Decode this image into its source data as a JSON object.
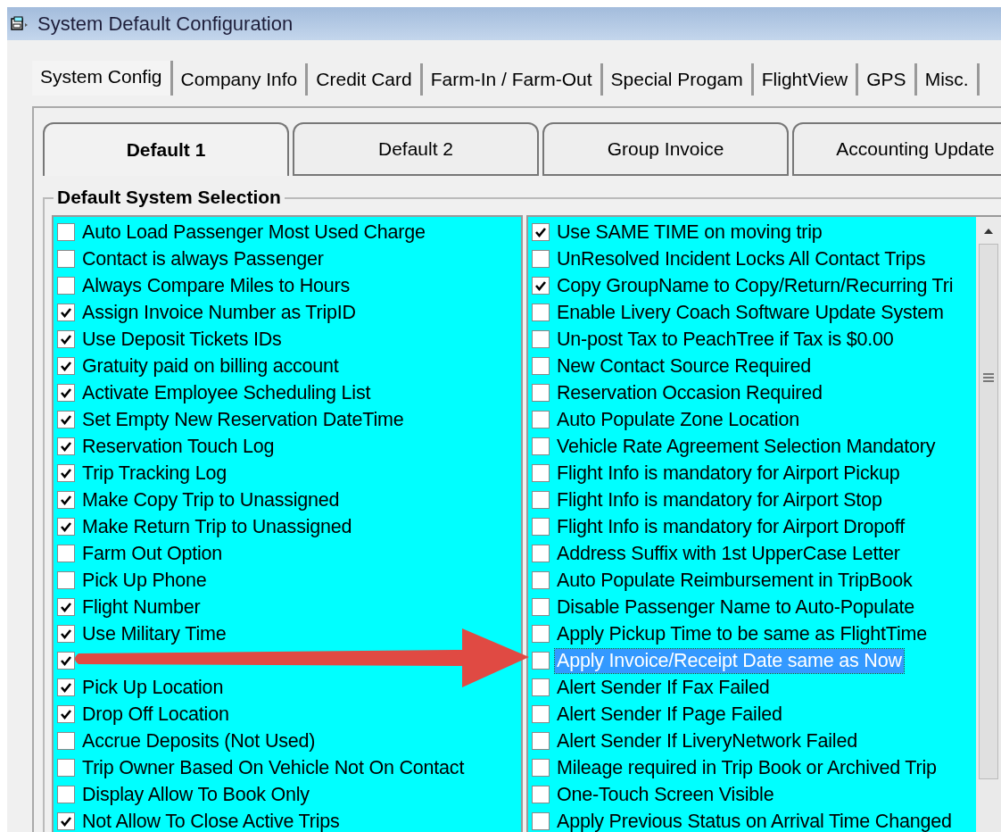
{
  "window": {
    "title": "System Default Configuration"
  },
  "tabs": [
    {
      "label": "System Config",
      "selected": true
    },
    {
      "label": "Company Info",
      "selected": false
    },
    {
      "label": "Credit Card",
      "selected": false
    },
    {
      "label": "Farm-In / Farm-Out",
      "selected": false
    },
    {
      "label": "Special Progam",
      "selected": false
    },
    {
      "label": "FlightView",
      "selected": false
    },
    {
      "label": "GPS",
      "selected": false
    },
    {
      "label": "Misc.",
      "selected": false
    }
  ],
  "subtabs": [
    {
      "label": "Default 1",
      "selected": true
    },
    {
      "label": "Default 2",
      "selected": false
    },
    {
      "label": "Group Invoice",
      "selected": false
    },
    {
      "label": "Accounting Update",
      "selected": false
    }
  ],
  "group": {
    "title": "Default System Selection"
  },
  "left_list": [
    {
      "label": "Auto Load Passenger Most Used Charge",
      "checked": false,
      "selected": false
    },
    {
      "label": "Contact is always Passenger",
      "checked": false,
      "selected": false
    },
    {
      "label": "Always Compare Miles to Hours",
      "checked": false,
      "selected": false
    },
    {
      "label": "Assign Invoice Number as TripID",
      "checked": true,
      "selected": false
    },
    {
      "label": "Use Deposit Tickets IDs",
      "checked": true,
      "selected": false
    },
    {
      "label": "Gratuity paid on billing account",
      "checked": true,
      "selected": false
    },
    {
      "label": "Activate Employee Scheduling List",
      "checked": true,
      "selected": false
    },
    {
      "label": "Set Empty New Reservation DateTime",
      "checked": true,
      "selected": false
    },
    {
      "label": "Reservation Touch Log",
      "checked": true,
      "selected": false
    },
    {
      "label": "Trip Tracking Log",
      "checked": true,
      "selected": false
    },
    {
      "label": "Make Copy Trip to Unassigned",
      "checked": true,
      "selected": false
    },
    {
      "label": "Make Return Trip to Unassigned",
      "checked": true,
      "selected": false
    },
    {
      "label": "Farm Out Option",
      "checked": false,
      "selected": false
    },
    {
      "label": "Pick Up Phone",
      "checked": false,
      "selected": false
    },
    {
      "label": "Flight Number",
      "checked": true,
      "selected": false
    },
    {
      "label": "Use Military Time",
      "checked": true,
      "selected": false
    },
    {
      "checked": true
    },
    {
      "label": "Pick Up Location",
      "checked": true,
      "selected": false
    },
    {
      "label": "Drop Off Location",
      "checked": true,
      "selected": false
    },
    {
      "label": "Accrue Deposits (Not Used)",
      "checked": false,
      "selected": false
    },
    {
      "label": "Trip Owner Based On Vehicle Not On Contact",
      "checked": false,
      "selected": false
    },
    {
      "label": "Display Allow To Book Only",
      "checked": false,
      "selected": false
    },
    {
      "label": "Not Allow To Close Active Trips",
      "checked": true,
      "selected": false
    }
  ],
  "right_list": [
    {
      "label": "Use SAME TIME on moving trip",
      "checked": true,
      "selected": false
    },
    {
      "label": "UnResolved Incident Locks All Contact Trips",
      "checked": false,
      "selected": false
    },
    {
      "label": "Copy GroupName to Copy/Return/Recurring Tri",
      "checked": true,
      "selected": false
    },
    {
      "label": "Enable Livery Coach Software Update System",
      "checked": false,
      "selected": false
    },
    {
      "label": "Un-post Tax to PeachTree if Tax is $0.00",
      "checked": false,
      "selected": false
    },
    {
      "label": "New Contact Source Required",
      "checked": false,
      "selected": false
    },
    {
      "label": "Reservation Occasion Required",
      "checked": false,
      "selected": false
    },
    {
      "label": "Auto Populate Zone Location",
      "checked": false,
      "selected": false
    },
    {
      "label": "Vehicle Rate Agreement Selection Mandatory",
      "checked": false,
      "selected": false
    },
    {
      "label": "Flight Info is mandatory for Airport Pickup",
      "checked": false,
      "selected": false
    },
    {
      "label": "Flight Info is mandatory for Airport Stop",
      "checked": false,
      "selected": false
    },
    {
      "label": "Flight Info is mandatory for Airport Dropoff",
      "checked": false,
      "selected": false
    },
    {
      "label": "Address Suffix with 1st UpperCase Letter",
      "checked": false,
      "selected": false
    },
    {
      "label": "Auto Populate Reimbursement in TripBook",
      "checked": false,
      "selected": false
    },
    {
      "label": "Disable Passenger Name to Auto-Populate",
      "checked": false,
      "selected": false
    },
    {
      "label": "Apply Pickup Time to be same as FlightTime",
      "checked": false,
      "selected": false
    },
    {
      "label": "Apply Invoice/Receipt Date same as Now",
      "checked": false,
      "selected": true
    },
    {
      "label": "Alert Sender If Fax Failed",
      "checked": false,
      "selected": false
    },
    {
      "label": "Alert Sender If Page Failed",
      "checked": false,
      "selected": false
    },
    {
      "label": "Alert Sender If LiveryNetwork Failed",
      "checked": false,
      "selected": false
    },
    {
      "label": "Mileage required in Trip Book or Archived Trip",
      "checked": false,
      "selected": false
    },
    {
      "label": "One-Touch Screen Visible",
      "checked": false,
      "selected": false
    },
    {
      "label": "Apply Previous Status on Arrival Time Changed",
      "checked": false,
      "selected": false
    }
  ]
}
